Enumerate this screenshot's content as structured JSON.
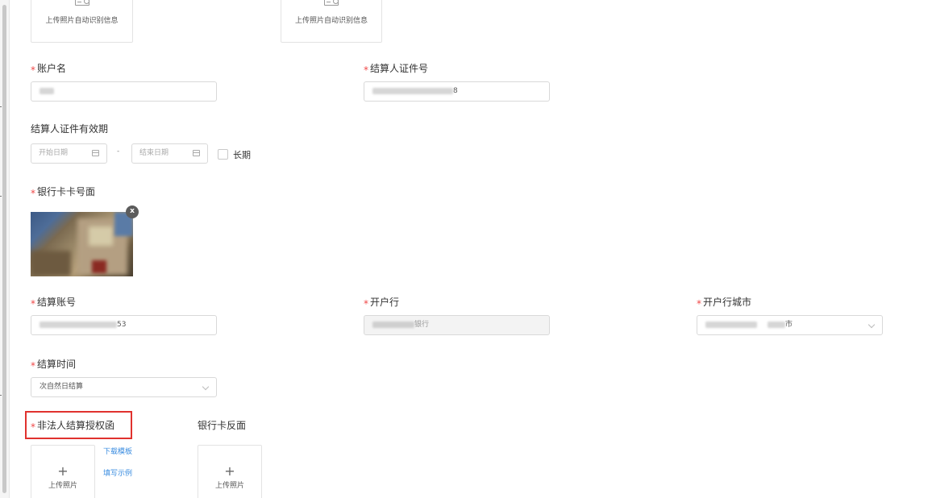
{
  "form": {
    "id_front_upload": {
      "caption": "上传照片自动识别信息"
    },
    "id_back_upload": {
      "caption": "上传照片自动识别信息"
    },
    "account_name": {
      "label": "账户名",
      "value": ""
    },
    "settler_id_number": {
      "label": "结算人证件号",
      "value": "8"
    },
    "id_validity": {
      "label": "结算人证件有效期",
      "start_placeholder": "开始日期",
      "separator": "-",
      "end_placeholder": "结束日期",
      "long_term_label": "长期"
    },
    "bank_card_front": {
      "label": "银行卡卡号面",
      "close_symbol": "x"
    },
    "settlement_account": {
      "label": "结算账号",
      "value": "53"
    },
    "opening_bank": {
      "label": "开户行",
      "value": "银行"
    },
    "opening_city": {
      "label": "开户行城市",
      "value": "市"
    },
    "settlement_time": {
      "label": "结算时间",
      "value": "次自然日结算"
    },
    "authorization_letter": {
      "label": "非法人结算授权函",
      "download_template": "下载模板",
      "fill_example": "填写示例",
      "upload_caption": "上传照片",
      "plus": "+"
    },
    "bank_card_back": {
      "label": "银行卡反面",
      "upload_caption": "上传照片",
      "plus": "+"
    },
    "required_mark": "*"
  },
  "colors": {
    "required": "#f04848",
    "link": "#3b8de0",
    "highlight": "#e0322e",
    "border": "#d9d9d9"
  }
}
